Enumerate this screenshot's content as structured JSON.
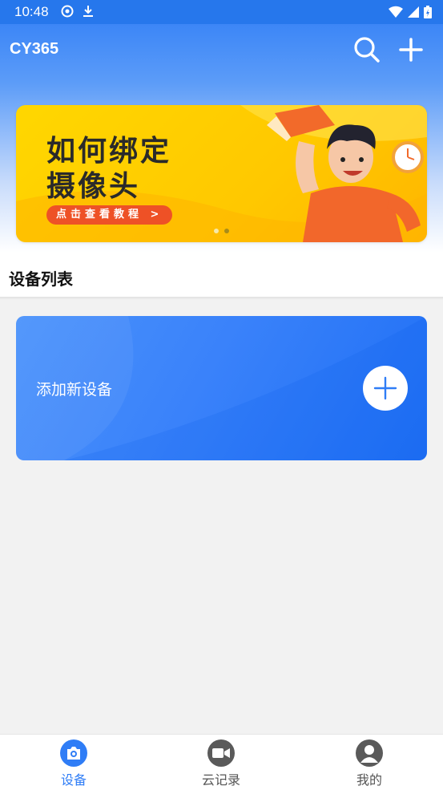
{
  "status_bar": {
    "time": "10:48",
    "icons": [
      "at-sign-icon",
      "download-icon",
      "wifi-icon",
      "signal-icon",
      "battery-icon"
    ]
  },
  "app_bar": {
    "title": "CY365",
    "actions": [
      "search-icon",
      "plus-icon"
    ]
  },
  "banner": {
    "line1": "如何绑定",
    "line2": "摄像头",
    "cta": "点击查看教程 >",
    "dot_count": 2,
    "active_dot": 2
  },
  "device_list": {
    "title": "设备列表",
    "add_device_label": "添加新设备"
  },
  "bottom_nav": {
    "items": [
      {
        "label": "设备",
        "icon": "camera-icon",
        "active": true
      },
      {
        "label": "云记录",
        "icon": "video-camera-icon",
        "active": false
      },
      {
        "label": "我的",
        "icon": "person-icon",
        "active": false
      }
    ]
  },
  "colors": {
    "primary": "#2f7df6",
    "status_bar": "#2677ec",
    "banner_yellow": "#ffc800",
    "cta_orange": "#ee5126",
    "inactive_icon": "#5a5a5a"
  }
}
